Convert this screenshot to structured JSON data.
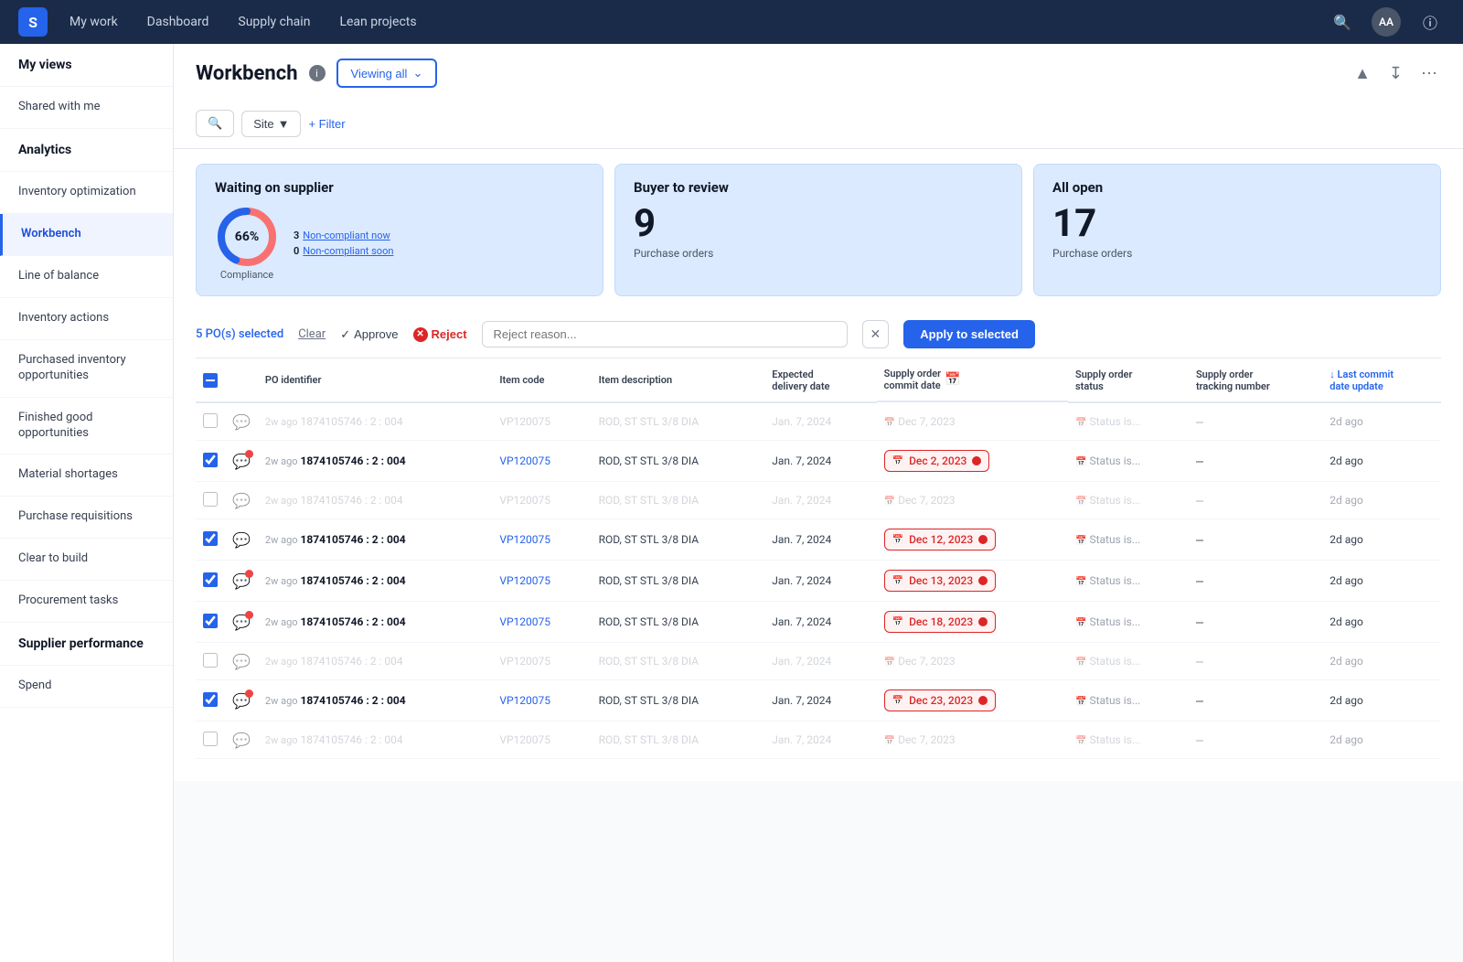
{
  "topNav": {
    "logo": "S",
    "links": [
      "My work",
      "Dashboard",
      "Supply chain",
      "Lean projects"
    ],
    "avatarLabel": "AA"
  },
  "sidebar": {
    "items": [
      {
        "label": "My views",
        "type": "section",
        "active": false
      },
      {
        "label": "Shared with me",
        "type": "item",
        "active": false
      },
      {
        "label": "Analytics",
        "type": "section",
        "active": false
      },
      {
        "label": "Inventory optimization",
        "type": "item",
        "active": false
      },
      {
        "label": "Workbench",
        "type": "item",
        "active": true
      },
      {
        "label": "Line of balance",
        "type": "item",
        "active": false
      },
      {
        "label": "Inventory actions",
        "type": "item",
        "active": false
      },
      {
        "label": "Purchased inventory opportunities",
        "type": "item",
        "active": false
      },
      {
        "label": "Finished good opportunities",
        "type": "item",
        "active": false
      },
      {
        "label": "Material shortages",
        "type": "item",
        "active": false
      },
      {
        "label": "Purchase requisitions",
        "type": "item",
        "active": false
      },
      {
        "label": "Clear to build",
        "type": "item",
        "active": false
      },
      {
        "label": "Procurement tasks",
        "type": "item",
        "active": false
      },
      {
        "label": "Supplier performance",
        "type": "section",
        "active": false
      },
      {
        "label": "Spend",
        "type": "item",
        "active": false
      }
    ]
  },
  "pageTitle": "Workbench",
  "viewingAllLabel": "Viewing all",
  "filterBar": {
    "searchPlaceholder": "Search",
    "siteLabel": "Site",
    "filterLabel": "+ Filter"
  },
  "cards": {
    "waitingOnSupplier": {
      "title": "Waiting on supplier",
      "compliance": 66,
      "complianceLabel": "Compliance",
      "stats": [
        {
          "num": "3",
          "label": "Non-compliant now"
        },
        {
          "num": "0",
          "label": "Non-compliant soon"
        }
      ]
    },
    "buyerToReview": {
      "title": "Buyer to review",
      "count": "9",
      "label": "Purchase orders"
    },
    "allOpen": {
      "title": "All open",
      "count": "17",
      "label": "Purchase orders"
    }
  },
  "selectionBar": {
    "selectedCount": "5 PO(s) selected",
    "clearLabel": "Clear",
    "approveLabel": "Approve",
    "rejectLabel": "Reject",
    "rejectPlaceholder": "Reject reason...",
    "applyLabel": "Apply to selected"
  },
  "tableHeaders": [
    "",
    "",
    "PO identifier",
    "Item code",
    "Item description",
    "Expected delivery date",
    "Supply order commit date",
    "Supply order status",
    "Supply order tracking number",
    "Last commit date update"
  ],
  "tableRows": [
    {
      "checked": false,
      "msgIcon": "gray",
      "age": "2w ago",
      "poId": "1874105746 : 2 : 004",
      "itemCode": "VP120075",
      "itemDesc": "ROD, ST STL 3/8 DIA",
      "deliveryDate": "Jan. 7, 2024",
      "commitDate": "Dec 7, 2023",
      "commitHighlighted": false,
      "status": "Status is...",
      "tracking": true,
      "lastUpdate": "2d ago"
    },
    {
      "checked": true,
      "msgIcon": "blue-badge",
      "age": "2w ago",
      "poId": "1874105746 : 2 : 004",
      "itemCode": "VP120075",
      "itemDesc": "ROD, ST STL 3/8 DIA",
      "deliveryDate": "Jan. 7, 2024",
      "commitDate": "Dec 2, 2023",
      "commitHighlighted": true,
      "status": "Status is...",
      "tracking": true,
      "lastUpdate": "2d ago"
    },
    {
      "checked": false,
      "msgIcon": "gray",
      "age": "2w ago",
      "poId": "1874105746 : 2 : 004",
      "itemCode": "VP120075",
      "itemDesc": "ROD, ST STL 3/8 DIA",
      "deliveryDate": "Jan. 7, 2024",
      "commitDate": "Dec 7, 2023",
      "commitHighlighted": false,
      "status": "Status is...",
      "tracking": true,
      "lastUpdate": "2d ago"
    },
    {
      "checked": true,
      "msgIcon": "blue-plain",
      "age": "2w ago",
      "poId": "1874105746 : 2 : 004",
      "itemCode": "VP120075",
      "itemDesc": "ROD, ST STL 3/8 DIA",
      "deliveryDate": "Jan. 7, 2024",
      "commitDate": "Dec 12, 2023",
      "commitHighlighted": true,
      "status": "Status is...",
      "tracking": true,
      "lastUpdate": "2d ago"
    },
    {
      "checked": true,
      "msgIcon": "blue-badge",
      "age": "2w ago",
      "poId": "1874105746 : 2 : 004",
      "itemCode": "VP120075",
      "itemDesc": "ROD, ST STL 3/8 DIA",
      "deliveryDate": "Jan. 7, 2024",
      "commitDate": "Dec 13, 2023",
      "commitHighlighted": true,
      "status": "Status is...",
      "tracking": true,
      "lastUpdate": "2d ago"
    },
    {
      "checked": true,
      "msgIcon": "blue-badge",
      "age": "2w ago",
      "poId": "1874105746 : 2 : 004",
      "itemCode": "VP120075",
      "itemDesc": "ROD, ST STL 3/8 DIA",
      "deliveryDate": "Jan. 7, 2024",
      "commitDate": "Dec 18, 2023",
      "commitHighlighted": true,
      "status": "Status is...",
      "tracking": true,
      "lastUpdate": "2d ago"
    },
    {
      "checked": false,
      "msgIcon": "gray",
      "age": "2w ago",
      "poId": "1874105746 : 2 : 004",
      "itemCode": "VP120075",
      "itemDesc": "ROD, ST STL 3/8 DIA",
      "deliveryDate": "Jan. 7, 2024",
      "commitDate": "Dec 7, 2023",
      "commitHighlighted": false,
      "status": "Status is...",
      "tracking": true,
      "lastUpdate": "2d ago"
    },
    {
      "checked": true,
      "msgIcon": "blue-badge",
      "age": "2w ago",
      "poId": "1874105746 : 2 : 004",
      "itemCode": "VP120075",
      "itemDesc": "ROD, ST STL 3/8 DIA",
      "deliveryDate": "Jan. 7, 2024",
      "commitDate": "Dec 23, 2023",
      "commitHighlighted": true,
      "status": "Status is...",
      "tracking": true,
      "lastUpdate": "2d ago"
    },
    {
      "checked": false,
      "msgIcon": "pink",
      "age": "2w ago",
      "poId": "1874105746 : 2 : 004",
      "itemCode": "VP120075",
      "itemDesc": "ROD, ST STL 3/8 DIA",
      "deliveryDate": "Jan. 7, 2024",
      "commitDate": "Dec 7, 2023",
      "commitHighlighted": false,
      "status": "Status is...",
      "tracking": true,
      "lastUpdate": "2d ago"
    }
  ]
}
